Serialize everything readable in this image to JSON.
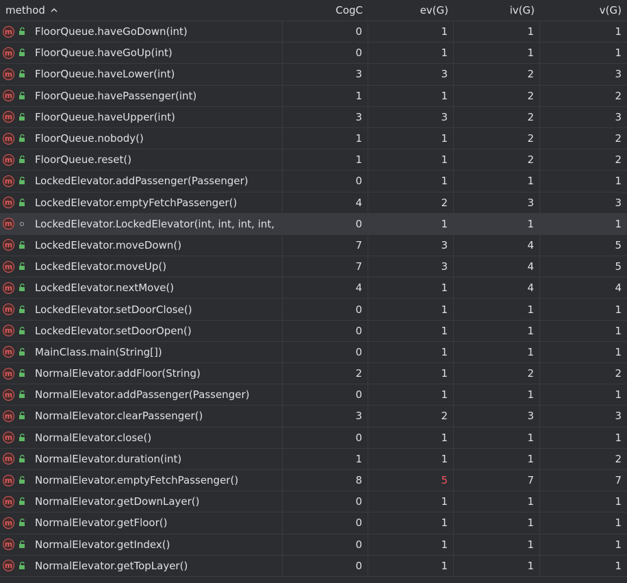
{
  "columns": {
    "method": "method",
    "cogc": "CogC",
    "ev": "ev(G)",
    "iv": "iv(G)",
    "v": "v(G)"
  },
  "sort": {
    "column": "method",
    "direction": "ascending"
  },
  "colors": {
    "background": "#2b2d30",
    "gridline": "#393b40",
    "selected_row": "#393b40",
    "method_icon": "#db5c5c",
    "public_icon": "#5fb865",
    "highlight_value": "#f75464",
    "text": "#dfe1e5"
  },
  "rows": [
    {
      "method": "FloorQueue.haveGoDown(int)",
      "visibility": "public",
      "cogc": "0",
      "ev": "1",
      "iv": "1",
      "v": "1"
    },
    {
      "method": "FloorQueue.haveGoUp(int)",
      "visibility": "public",
      "cogc": "0",
      "ev": "1",
      "iv": "1",
      "v": "1"
    },
    {
      "method": "FloorQueue.haveLower(int)",
      "visibility": "public",
      "cogc": "3",
      "ev": "3",
      "iv": "2",
      "v": "3"
    },
    {
      "method": "FloorQueue.havePassenger(int)",
      "visibility": "public",
      "cogc": "1",
      "ev": "1",
      "iv": "2",
      "v": "2"
    },
    {
      "method": "FloorQueue.haveUpper(int)",
      "visibility": "public",
      "cogc": "3",
      "ev": "3",
      "iv": "2",
      "v": "3"
    },
    {
      "method": "FloorQueue.nobody()",
      "visibility": "public",
      "cogc": "1",
      "ev": "1",
      "iv": "2",
      "v": "2"
    },
    {
      "method": "FloorQueue.reset()",
      "visibility": "public",
      "cogc": "1",
      "ev": "1",
      "iv": "2",
      "v": "2"
    },
    {
      "method": "LockedElevator.addPassenger(Passenger)",
      "visibility": "public",
      "cogc": "0",
      "ev": "1",
      "iv": "1",
      "v": "1"
    },
    {
      "method": "LockedElevator.emptyFetchPassenger()",
      "visibility": "public",
      "cogc": "4",
      "ev": "2",
      "iv": "3",
      "v": "3"
    },
    {
      "method": "LockedElevator.LockedElevator(int, int, int, int,",
      "visibility": "package",
      "cogc": "0",
      "ev": "1",
      "iv": "1",
      "v": "1",
      "selected": true
    },
    {
      "method": "LockedElevator.moveDown()",
      "visibility": "public",
      "cogc": "7",
      "ev": "3",
      "iv": "4",
      "v": "5"
    },
    {
      "method": "LockedElevator.moveUp()",
      "visibility": "public",
      "cogc": "7",
      "ev": "3",
      "iv": "4",
      "v": "5"
    },
    {
      "method": "LockedElevator.nextMove()",
      "visibility": "public",
      "cogc": "4",
      "ev": "1",
      "iv": "4",
      "v": "4"
    },
    {
      "method": "LockedElevator.setDoorClose()",
      "visibility": "public",
      "cogc": "0",
      "ev": "1",
      "iv": "1",
      "v": "1"
    },
    {
      "method": "LockedElevator.setDoorOpen()",
      "visibility": "public",
      "cogc": "0",
      "ev": "1",
      "iv": "1",
      "v": "1"
    },
    {
      "method": "MainClass.main(String[])",
      "visibility": "public",
      "cogc": "0",
      "ev": "1",
      "iv": "1",
      "v": "1"
    },
    {
      "method": "NormalElevator.addFloor(String)",
      "visibility": "public",
      "cogc": "2",
      "ev": "1",
      "iv": "2",
      "v": "2"
    },
    {
      "method": "NormalElevator.addPassenger(Passenger)",
      "visibility": "public",
      "cogc": "0",
      "ev": "1",
      "iv": "1",
      "v": "1"
    },
    {
      "method": "NormalElevator.clearPassenger()",
      "visibility": "public",
      "cogc": "3",
      "ev": "2",
      "iv": "3",
      "v": "3"
    },
    {
      "method": "NormalElevator.close()",
      "visibility": "public",
      "cogc": "0",
      "ev": "1",
      "iv": "1",
      "v": "1"
    },
    {
      "method": "NormalElevator.duration(int)",
      "visibility": "public",
      "cogc": "1",
      "ev": "1",
      "iv": "1",
      "v": "2"
    },
    {
      "method": "NormalElevator.emptyFetchPassenger()",
      "visibility": "public",
      "cogc": "8",
      "ev": "5",
      "iv": "7",
      "v": "7",
      "ev_highlight": true
    },
    {
      "method": "NormalElevator.getDownLayer()",
      "visibility": "public",
      "cogc": "0",
      "ev": "1",
      "iv": "1",
      "v": "1"
    },
    {
      "method": "NormalElevator.getFloor()",
      "visibility": "public",
      "cogc": "0",
      "ev": "1",
      "iv": "1",
      "v": "1"
    },
    {
      "method": "NormalElevator.getIndex()",
      "visibility": "public",
      "cogc": "0",
      "ev": "1",
      "iv": "1",
      "v": "1"
    },
    {
      "method": "NormalElevator.getTopLayer()",
      "visibility": "public",
      "cogc": "0",
      "ev": "1",
      "iv": "1",
      "v": "1"
    }
  ]
}
